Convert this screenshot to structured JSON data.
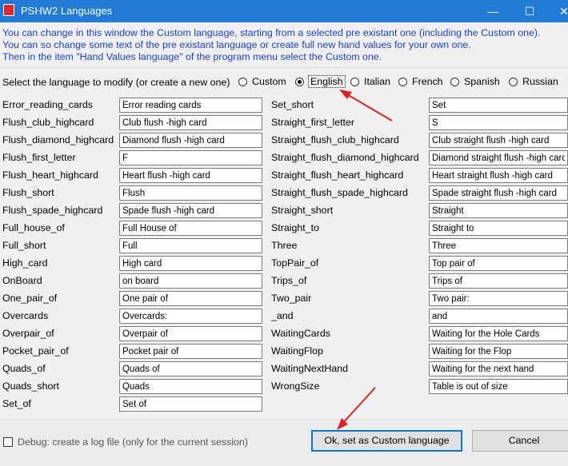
{
  "window": {
    "title": "PSHW2 Languages",
    "minimize_glyph": "—",
    "maximize_glyph": "☐",
    "close_glyph": "✕"
  },
  "description": [
    "You can change in this window the Custom language, starting from a selected pre existant one (including the Custom one).",
    "You can so change some text of the pre existant language or create full new hand values for your own one.",
    "Then in the item \"Hand Values language\" of the program menu select the Custom one."
  ],
  "language_select": {
    "label": "Select the language to modify (or create a new one)",
    "options": [
      "Custom",
      "English",
      "Italian",
      "French",
      "Spanish",
      "Russian"
    ],
    "selected": "English"
  },
  "fields_left": [
    {
      "key": "Error_reading_cards",
      "value": "Error reading cards"
    },
    {
      "key": "Flush_club_highcard",
      "value": "Club flush -high card"
    },
    {
      "key": "Flush_diamond_highcard",
      "value": "Diamond flush -high card"
    },
    {
      "key": "Flush_first_letter",
      "value": "F"
    },
    {
      "key": "Flush_heart_highcard",
      "value": "Heart flush -high card"
    },
    {
      "key": "Flush_short",
      "value": "Flush"
    },
    {
      "key": "Flush_spade_highcard",
      "value": "Spade flush -high card"
    },
    {
      "key": "Full_house_of",
      "value": "Full House of"
    },
    {
      "key": "Full_short",
      "value": "Full"
    },
    {
      "key": "High_card",
      "value": "High card"
    },
    {
      "key": "OnBoard",
      "value": "on board"
    },
    {
      "key": "One_pair_of",
      "value": "One pair of"
    },
    {
      "key": "Overcards",
      "value": "Overcards:"
    },
    {
      "key": "Overpair_of",
      "value": "Overpair of"
    },
    {
      "key": "Pocket_pair_of",
      "value": "Pocket pair of"
    },
    {
      "key": "Quads_of",
      "value": "Quads of"
    },
    {
      "key": "Quads_short",
      "value": "Quads"
    },
    {
      "key": "Set_of",
      "value": "Set of"
    }
  ],
  "fields_right": [
    {
      "key": "Set_short",
      "value": "Set"
    },
    {
      "key": "Straight_first_letter",
      "value": "S"
    },
    {
      "key": "Straight_flush_club_highcard",
      "value": "Club straight flush -high card"
    },
    {
      "key": "Straight_flush_diamond_highcard",
      "value": "Diamond straight flush -high card"
    },
    {
      "key": "Straight_flush_heart_highcard",
      "value": "Heart straight flush -high card"
    },
    {
      "key": "Straight_flush_spade_highcard",
      "value": "Spade straight flush -high card"
    },
    {
      "key": "Straight_short",
      "value": "Straight"
    },
    {
      "key": "Straight_to",
      "value": "Straight to"
    },
    {
      "key": "Three",
      "value": "Three"
    },
    {
      "key": "TopPair_of",
      "value": "Top pair of"
    },
    {
      "key": "Trips_of",
      "value": "Trips of"
    },
    {
      "key": "Two_pair",
      "value": "Two pair:"
    },
    {
      "key": "_and",
      "value": "and"
    },
    {
      "key": "WaitingCards",
      "value": "Waiting for the Hole Cards"
    },
    {
      "key": "WaitingFlop",
      "value": "Waiting for the Flop"
    },
    {
      "key": "WaitingNextHand",
      "value": "Waiting for the next hand"
    },
    {
      "key": "WrongSize",
      "value": "Table is out of size"
    }
  ],
  "debug": {
    "label": "Debug: create a log file (only for the current session)",
    "checked": false
  },
  "buttons": {
    "ok": "Ok, set as Custom language",
    "cancel": "Cancel"
  },
  "colors": {
    "titlebar": "#1f7bd6",
    "description_text": "#1a3ed8",
    "annotation_arrow": "#e02020"
  },
  "icons": {
    "app": "app-icon",
    "annotation": "red-arrow"
  }
}
